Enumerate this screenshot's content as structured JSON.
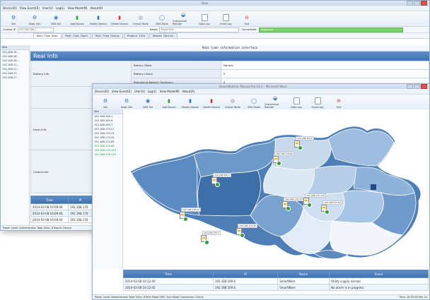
{
  "back": {
    "menu": [
      "Device(D)",
      "View Event(E)",
      "User(U)",
      "Log(L)",
      "View Mode(M)",
      "About(A)"
    ],
    "toolbar": [
      {
        "label": "Set",
        "icon": "gear-icon"
      },
      {
        "label": "Basic Set",
        "icon": "basic-set-icon"
      },
      {
        "label": "SMS Set",
        "icon": "sms-icon"
      },
      {
        "label": "Add Device",
        "icon": "add-device-icon"
      },
      {
        "label": "Modify Device",
        "icon": "modify-device-icon"
      },
      {
        "label": "Delete Device",
        "icon": "delete-device-icon"
      },
      {
        "label": "Virtual Mode",
        "icon": "virtual-mode-icon"
      },
      {
        "label": "SMS Mode",
        "icon": "sms-mode-icon"
      },
      {
        "label": "Customized Remote",
        "icon": "remote-icon"
      },
      {
        "label": "Data Log",
        "icon": "data-log-icon"
      },
      {
        "label": "Event Log",
        "icon": "event-log-icon"
      },
      {
        "label": "Exit",
        "icon": "exit-icon"
      }
    ],
    "current_ip_label": "Current IP",
    "current_ip_value": "192.168.169.1",
    "name_label": "Name",
    "name_value": "Smart Pure",
    "commstate_label": "CommState",
    "commstate_value": "Supported",
    "tabs": [
      "Real-Time Data",
      "Real-Time Chart",
      "Real-Time Status",
      "Product Info",
      "Remote Control"
    ],
    "sidebar_header": "Site",
    "sidebar_ips": [
      "192.168.16...",
      "192.168.16...",
      "192.168.16...",
      "192.168.17...",
      "192.168.17...",
      "192.168.17...",
      "192.168.17..."
    ],
    "info_banner": "Real-time information interface",
    "section": "Real Info",
    "rows": [
      {
        "group": "Battery Info",
        "name": "Battery State",
        "value": "Normal"
      },
      {
        "group": "",
        "name": "Battery Life(s)",
        "value": "0"
      },
      {
        "group": "",
        "name": "Remaining Battery Time(min)",
        "value": "0"
      }
    ],
    "groups": [
      "Battery Info",
      "Input Info",
      "Output Info"
    ],
    "events": {
      "headers": [
        "Time",
        "IP"
      ],
      "rows": [
        [
          "2014-03-08 16:09:46",
          "192.168.170"
        ],
        [
          "2014-03-08 16:09:46",
          "192.168.170"
        ],
        [
          "2014-03-08 16:09:46",
          "192.168.170"
        ]
      ]
    },
    "status": "Power Level: Administrator   Total Units: 8   Result: Device"
  },
  "front": {
    "title": "SmartWatcher Manual Pro V2.0 - Microsoft Word",
    "menu": [
      "Device(D)",
      "View Event(E)",
      "User(U)",
      "Log(L)",
      "View Mode(M)",
      "About(A)"
    ],
    "toolbar": [
      {
        "label": "Set",
        "icon": "gear-icon"
      },
      {
        "label": "Basic Set",
        "icon": "basic-set-icon"
      },
      {
        "label": "SMS Set",
        "icon": "sms-icon"
      },
      {
        "label": "Add Device",
        "icon": "add-device-icon"
      },
      {
        "label": "Modify Device",
        "icon": "modify-device-icon"
      },
      {
        "label": "Delete Device",
        "icon": "delete-device-icon"
      },
      {
        "label": "Virtual Mode",
        "icon": "virtual-mode-icon"
      },
      {
        "label": "SMS Mode",
        "icon": "sms-mode-icon"
      },
      {
        "label": "Customized Remote",
        "icon": "remote-icon"
      },
      {
        "label": "Data Log",
        "icon": "data-log-icon"
      },
      {
        "label": "Event Log",
        "icon": "event-log-icon"
      },
      {
        "label": "Exit",
        "icon": "exit-icon"
      }
    ],
    "sidebar_header": "Site",
    "sidebar_ips": [
      {
        "ip": "192.168.169.1",
        "color": "#224455"
      },
      {
        "ip": "192.168.169.6",
        "color": "#224455"
      },
      {
        "ip": "192.168.169.7",
        "color": "#224455"
      },
      {
        "ip": "192.168.170.21",
        "color": "#224455"
      },
      {
        "ip": "192.168.170.23",
        "color": "#224455"
      },
      {
        "ip": "192.168.170.45",
        "color": "#224455"
      },
      {
        "ip": "192.168.170.65",
        "color": "#224455"
      },
      {
        "ip": "192.168.170.66",
        "color": "#1b9a3b"
      },
      {
        "ip": "192.168.170.125",
        "color": "#1b9a3b"
      },
      {
        "ip": "192.168.170.129",
        "color": "#1b9a3b"
      }
    ],
    "map_markers": [
      {
        "label": "192.168.170.68",
        "status": "normal"
      },
      {
        "label": "192.168.169.6",
        "status": "normal"
      },
      {
        "label": "192.168.169.1",
        "status": "normal"
      },
      {
        "label": "192.168.170.125",
        "status": "normal"
      },
      {
        "label": "192.168.170.21",
        "status": "normal"
      },
      {
        "label": "192.168.170.66",
        "status": "normal"
      },
      {
        "label": "192.168.170.45",
        "status": "normal"
      },
      {
        "label": "192.168.170.129",
        "status": "normal"
      },
      {
        "label": "192.168.170.7",
        "status": "normal"
      }
    ],
    "events": {
      "headers": [
        "Time",
        "IP",
        "Name",
        "Event"
      ],
      "rows": [
        [
          "2014-03-08 16:12:40",
          "192.168.169.6",
          "SmartWare",
          "Utility supply normal."
        ],
        [
          "2014-03-08 16:12:45",
          "192.168.169.6",
          "SmartWare",
          "No alarm is in progress."
        ]
      ]
    },
    "status_left": "Power Level: Administrator   Total Units: 8   Real Mode   SMS: True Mode   Connection: Online",
    "status_right": "Time: 16:35:26 Mar 14"
  }
}
